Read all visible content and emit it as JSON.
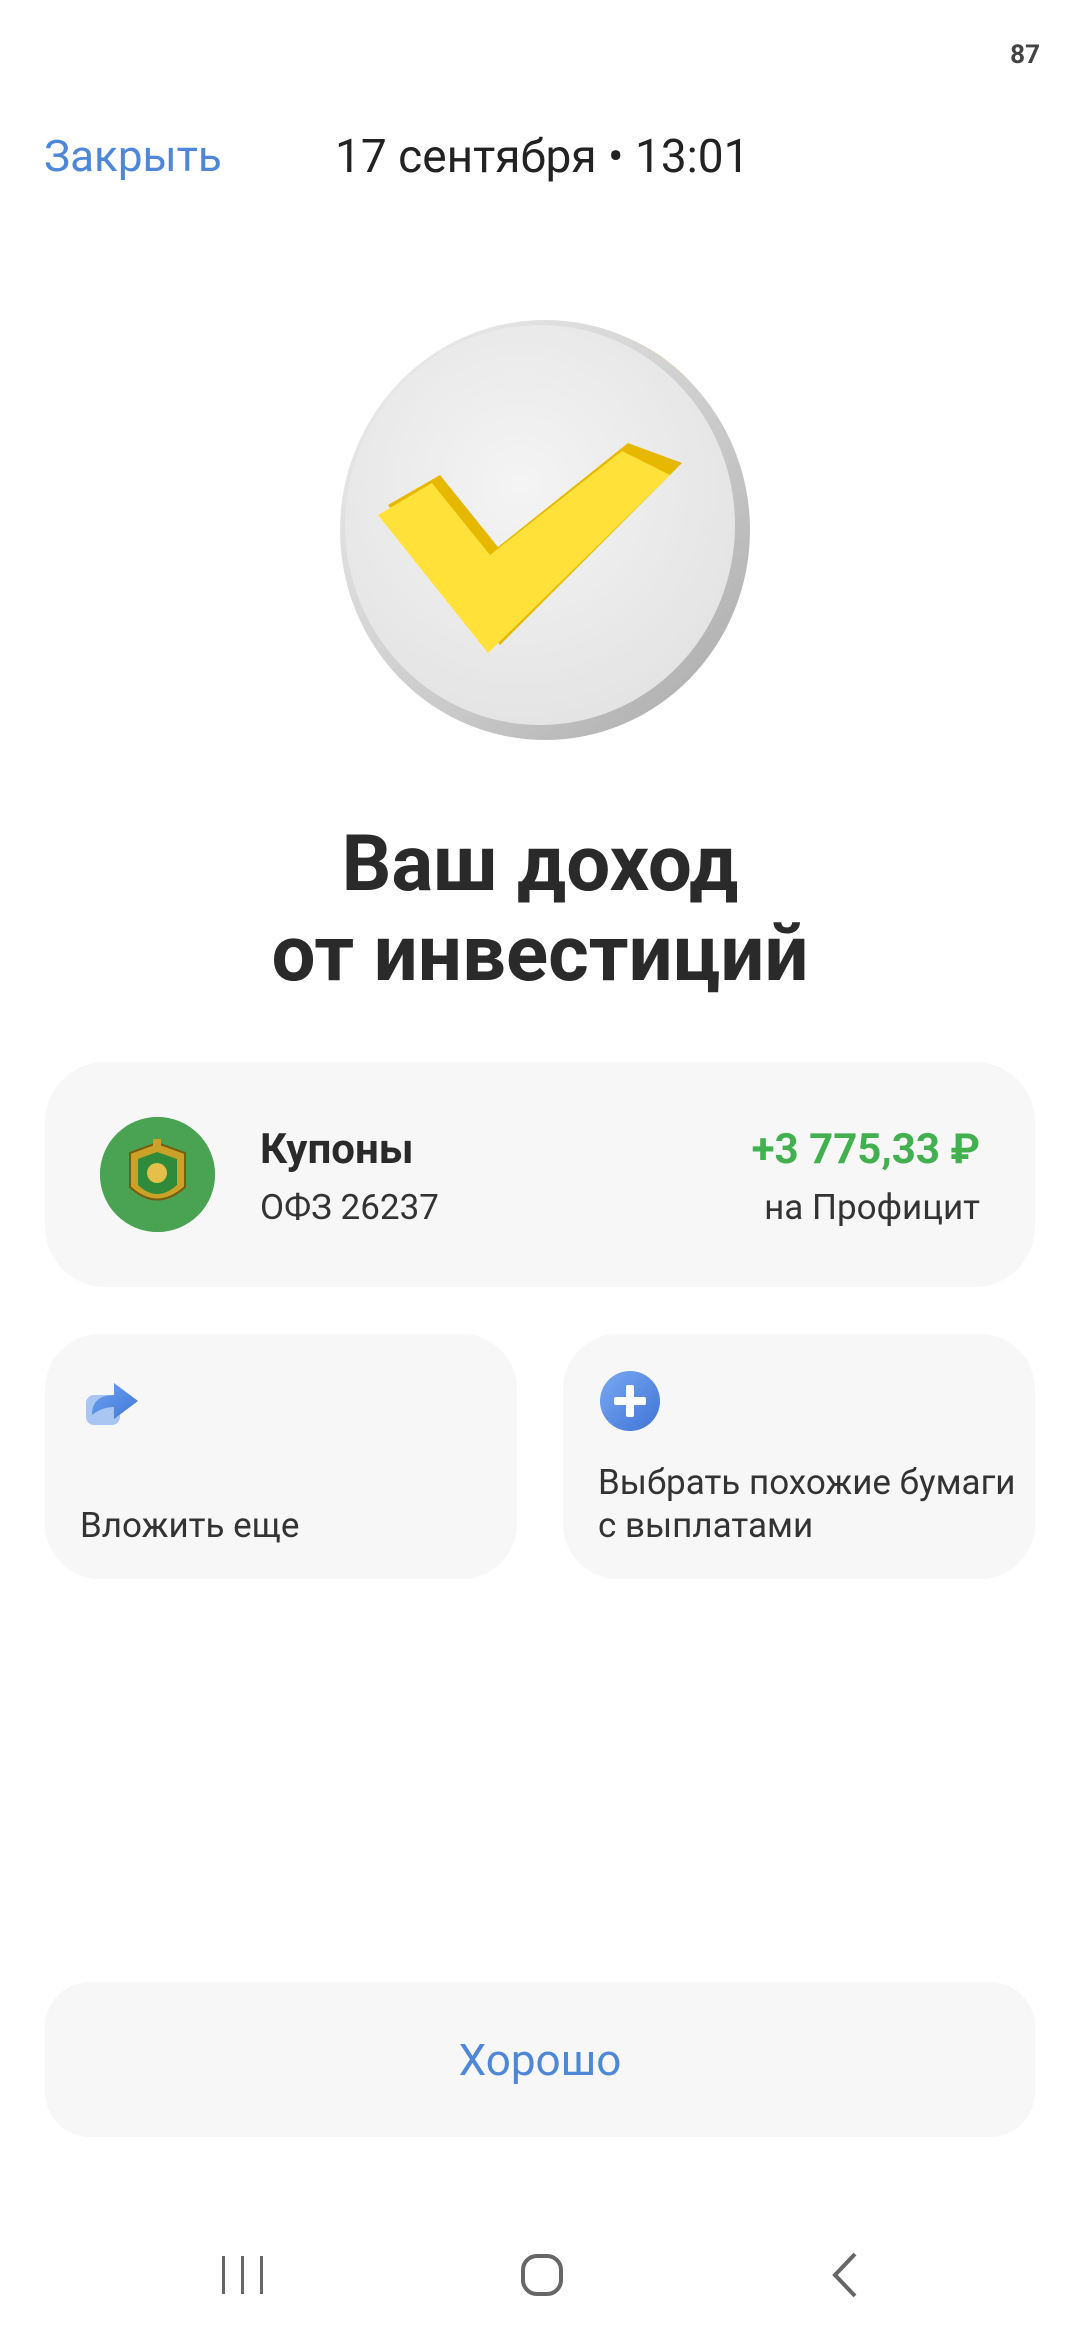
{
  "status_bar": {
    "battery": "87"
  },
  "header": {
    "close_label": "Закрыть",
    "datetime": "17 сентября • 13:01"
  },
  "hero": {
    "icon": "yellow-checkmark-coin-icon"
  },
  "title": {
    "line1": "Ваш доход",
    "line2": "от инвестиций"
  },
  "income": {
    "type": "Купоны",
    "asset": "ОФЗ 26237",
    "amount": "+3 775,33 ₽",
    "account": "на Профицит",
    "amount_color": "#43b04f",
    "logo": "minfin-emblem-icon"
  },
  "actions": [
    {
      "label": "Вложить еще",
      "icon": "reinvest-arrow-icon"
    },
    {
      "label": "Выбрать похожие бумаги с выплатами",
      "icon": "plus-circle-icon"
    }
  ],
  "ok_button": {
    "label": "Хорошо"
  },
  "colors": {
    "accent": "#4f87d8",
    "positive": "#43b04f",
    "card_bg": "#f6f7f6"
  },
  "nav": [
    "recent-apps-icon",
    "home-icon",
    "back-icon"
  ]
}
